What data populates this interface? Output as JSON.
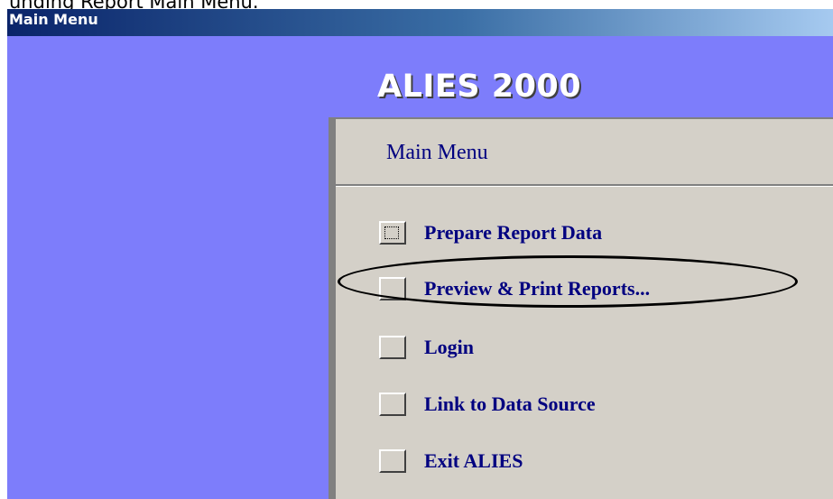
{
  "caption": "unding Report Main Menu.",
  "window": {
    "title": "Main Menu"
  },
  "app": {
    "title": "ALIES 2000"
  },
  "panel": {
    "header": "Main Menu",
    "items": [
      {
        "label": "Prepare Report Data"
      },
      {
        "label": "Preview & Print Reports..."
      },
      {
        "label": "Login"
      },
      {
        "label": "Link to Data Source"
      },
      {
        "label": "Exit ALIES"
      }
    ]
  },
  "colors": {
    "background": "#7d7dfb",
    "panel": "#d4d0c8",
    "label": "#000080",
    "title_bar_start": "#0a246a",
    "title_bar_end": "#a6caf0"
  }
}
